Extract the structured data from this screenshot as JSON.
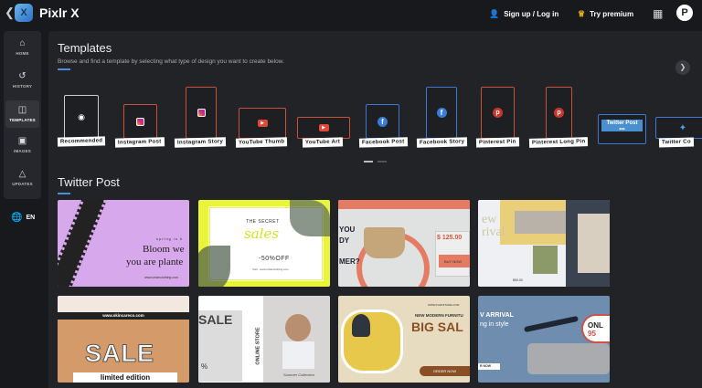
{
  "app": {
    "title": "Pixlr X",
    "logo_letter": "X"
  },
  "topbar": {
    "signup": "Sign up / Log in",
    "premium": "Try premium"
  },
  "sidebar": {
    "items": [
      {
        "label": "HOME",
        "icon": "home-icon"
      },
      {
        "label": "HISTORY",
        "icon": "history-icon"
      },
      {
        "label": "TEMPLATES",
        "icon": "templates-icon"
      },
      {
        "label": "IMAGES",
        "icon": "images-icon"
      },
      {
        "label": "UPDATES",
        "icon": "megaphone-icon"
      }
    ],
    "language": "EN"
  },
  "templates": {
    "title": "Templates",
    "subtitle": "Browse and find a template by selecting what type of design you want to create below.",
    "types": [
      "Recommended",
      "Instagram Post",
      "Instagram Story",
      "YouTube Thumb",
      "YouTube Art",
      "Facebook Post",
      "Facebook Story",
      "Pinterest Pin",
      "Pinterest Long Pin",
      "Twitter Post",
      "Twitter Co"
    ],
    "selected": "Twitter Post",
    "selected_dots": "•••"
  },
  "section": {
    "title": "Twitter Post"
  },
  "thumbs": {
    "t1": {
      "small": "spring is h",
      "line1": "Bloom we",
      "line2": "you are plante",
      "url": "www.urbanclothing.com"
    },
    "t2": {
      "top": "THE SECRET",
      "script": "sales",
      "off": "-50%OFF",
      "url": "Visit : www.urbanclothing.com"
    },
    "t3": {
      "line1": "YOU",
      "line2": "DY",
      "line3": "MER?",
      "price": "$ 125.00",
      "btn": "BUY NOW"
    },
    "t4": {
      "arrival": "ew\nrival",
      "price": "$50.00"
    },
    "t5": {
      "url": "www.skincareco.com",
      "sale": "SALE",
      "sub": "limited edition"
    },
    "t6": {
      "sale": "SALE",
      "pct": "%",
      "store": "ONLINE STORE",
      "script": "Summer Collection"
    },
    "t7": {
      "url": "WWW.FURNITURE.COM",
      "top": "NEW MODERN FURNITU",
      "big": "BIG SAL",
      "btn": "ORDER NOW"
    },
    "t8": {
      "l1": "V ARRIVAL",
      "l2": "ng in style",
      "btn": "R NOW",
      "badge1": "ONL",
      "badge2": "95"
    }
  }
}
